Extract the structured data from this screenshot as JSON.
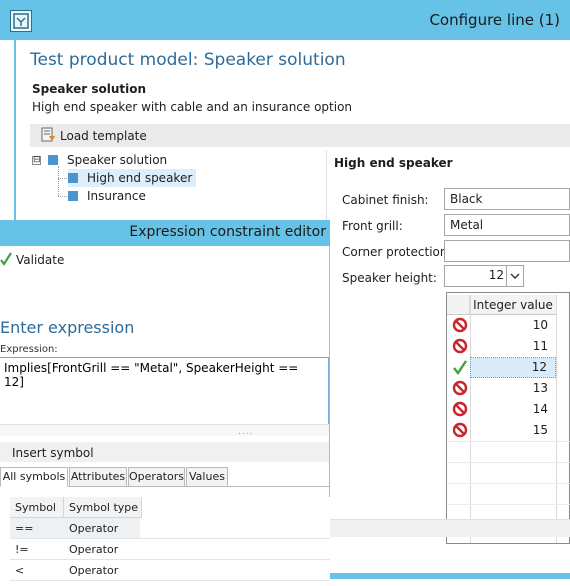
{
  "configure_window": {
    "title": "Configure line (1)",
    "model_title": "Test product model: Speaker solution",
    "model_name": "Speaker solution",
    "model_description": "High end speaker with cable and an insurance option",
    "load_template_label": "Load template",
    "tree": {
      "expander_symbol": "⊟",
      "root": "Speaker solution",
      "children": [
        "High end speaker",
        "Insurance"
      ],
      "selected": "High end speaker"
    },
    "attributes": {
      "heading": "High end speaker",
      "fields": [
        {
          "label": "Cabinet finish:",
          "value": "Black"
        },
        {
          "label": "Front grill:",
          "value": "Metal"
        },
        {
          "label": "Corner protection:",
          "value": ""
        },
        {
          "label": "Speaker height:",
          "value": "12"
        }
      ]
    },
    "dropdown": {
      "column_header": "Integer value",
      "rows": [
        {
          "value": "10",
          "status": "invalid",
          "icon": "prohibited-icon"
        },
        {
          "value": "11",
          "status": "invalid",
          "icon": "prohibited-icon"
        },
        {
          "value": "12",
          "status": "valid",
          "icon": "checkmark-icon",
          "selected": true
        },
        {
          "value": "13",
          "status": "invalid",
          "icon": "prohibited-icon"
        },
        {
          "value": "14",
          "status": "invalid",
          "icon": "prohibited-icon"
        },
        {
          "value": "15",
          "status": "invalid",
          "icon": "prohibited-icon"
        }
      ]
    }
  },
  "expression_editor": {
    "title": "Expression constraint editor",
    "validate_label": "Validate",
    "heading": "Enter expression",
    "expression_label": "Expression:",
    "expression_value": "Implies[FrontGrill == \"Metal\", SpeakerHeight == 12]",
    "splitter_grip": "....",
    "insert_symbol_label": "Insert symbol",
    "tabs": [
      "All symbols",
      "Attributes",
      "Operators",
      "Values"
    ],
    "active_tab": "All symbols",
    "symbol_table": {
      "columns": [
        "Symbol",
        "Symbol type"
      ],
      "rows": [
        [
          "==",
          "Operator"
        ],
        [
          "!=",
          "Operator"
        ],
        [
          "<",
          "Operator"
        ]
      ]
    }
  },
  "colors": {
    "titlebar": "#66c2e6",
    "heading_blue": "#2d6b9a",
    "tree_square": "#4a94d0",
    "valid_green": "#3aa63a",
    "invalid_red": "#c8262e"
  }
}
